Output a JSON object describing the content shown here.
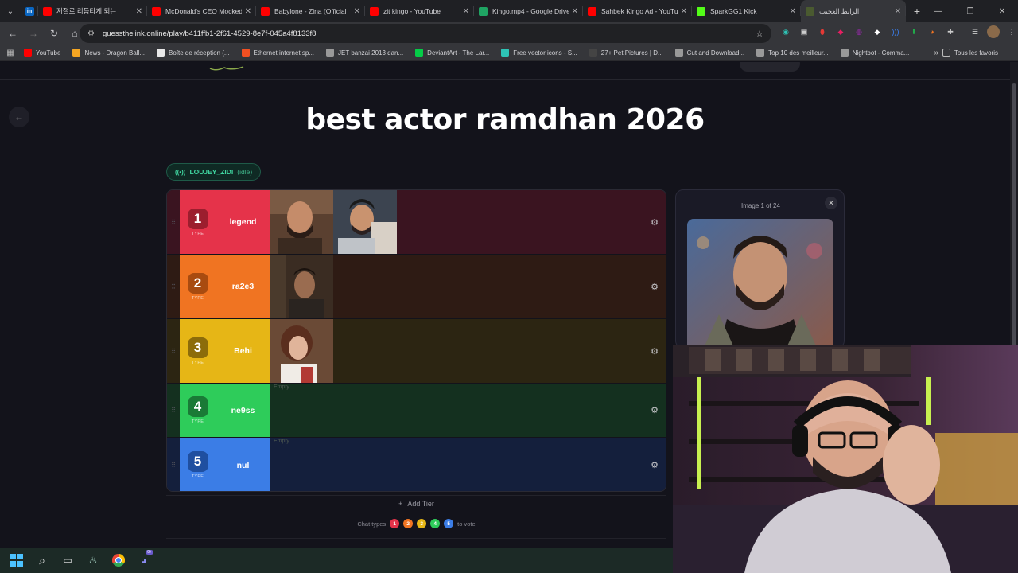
{
  "browser": {
    "tabs": [
      {
        "title": "저절로 리듬타게 되는",
        "color": "#ff0000"
      },
      {
        "title": "McDonald's CEO Mocked",
        "color": "#ff0000"
      },
      {
        "title": "Babylone - Zina (Official",
        "color": "#ff0000"
      },
      {
        "title": "zit kingo - YouTube",
        "color": "#ff0000"
      },
      {
        "title": "Kingo.mp4 - Google Drive",
        "color": "#1fa463"
      },
      {
        "title": "Sahbek Kingo Ad - YouTube",
        "color": "#ff0000"
      },
      {
        "title": "SparkGG1 Kick",
        "color": "#53fc18"
      }
    ],
    "active_tab_title": "الرابط العجيب",
    "url": "guessthelink.online/play/b411ffb1-2f61-4529-8e7f-045a4f8133f8",
    "bookmarks": [
      {
        "label": "YouTube",
        "color": "#ff0000"
      },
      {
        "label": "News - Dragon Ball...",
        "color": "#f5a623"
      },
      {
        "label": "Boîte de réception (...",
        "color": "#e8e8e8"
      },
      {
        "label": "Ethernet internet sp...",
        "color": "#f25022"
      },
      {
        "label": "JET banzai 2013 dan...",
        "color": "#999999"
      },
      {
        "label": "DeviantArt - The Lar...",
        "color": "#05cc47"
      },
      {
        "label": "Free vector icons - S...",
        "color": "#2ec4b6"
      },
      {
        "label": "27+ Pet Pictures | D...",
        "color": "#444444"
      },
      {
        "label": "Cut and Download...",
        "color": "#999999"
      },
      {
        "label": "Top 10 des meilleur...",
        "color": "#999999"
      },
      {
        "label": "Nightbot - Comma...",
        "color": "#999999"
      }
    ],
    "all_bookmarks_label": "Tous les favoris"
  },
  "page": {
    "title": "best actor ramdhan 2026",
    "status": {
      "user": "LOUJEY_ZIDI",
      "state": "(idle)"
    },
    "tiers": [
      {
        "num": "1",
        "type_label": "TYPE",
        "name": "legend",
        "bg": "#3a1420",
        "rank_color": "#e5334a",
        "num_bg": "#9c1e2e",
        "items": 2,
        "empty": false
      },
      {
        "num": "2",
        "type_label": "TYPE",
        "name": "ra2e3",
        "bg": "#2e1b14",
        "rank_color": "#f07422",
        "num_bg": "#a84b10",
        "items": 1,
        "empty": false
      },
      {
        "num": "3",
        "type_label": "TYPE",
        "name": "Behi",
        "bg": "#2c2512",
        "rank_color": "#e6b616",
        "num_bg": "#8c6c0a",
        "items": 1,
        "empty": false
      },
      {
        "num": "4",
        "type_label": "TYPE",
        "name": "ne9ss",
        "bg": "#14301f",
        "rank_color": "#2ecc5a",
        "num_bg": "#1a7a36",
        "items": 0,
        "empty": true
      },
      {
        "num": "5",
        "type_label": "TYPE",
        "name": "nul",
        "bg": "#141f3c",
        "rank_color": "#3b7de6",
        "num_bg": "#1f4fa0",
        "items": 0,
        "empty": true
      }
    ],
    "empty_label": "Empty",
    "add_tier_label": "Add Tier",
    "chat_types": {
      "prefix": "Chat types",
      "suffix": "to vote",
      "options": [
        {
          "label": "1",
          "color": "#e5334a"
        },
        {
          "label": "2",
          "color": "#f07422"
        },
        {
          "label": "3",
          "color": "#e6b616"
        },
        {
          "label": "4",
          "color": "#2ecc5a"
        },
        {
          "label": "5",
          "color": "#3b7de6"
        }
      ]
    },
    "preview": {
      "counter": "Image 1 of 24"
    }
  }
}
